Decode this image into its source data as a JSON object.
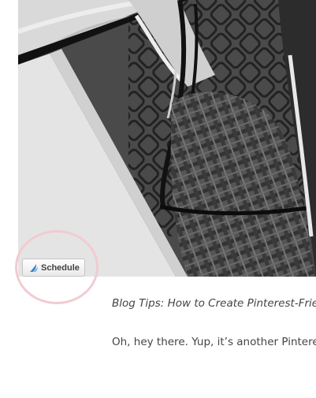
{
  "photo": {
    "alt": "Black and white photo of a person in a plaid sweater holding glasses by a chain-link fence"
  },
  "schedule_button": {
    "label": "Schedule",
    "icon": "buffer-icon",
    "icon_color": "#3b83c4"
  },
  "post": {
    "caption": "Blog Tips: How to Create Pinterest-Friendl",
    "body_text": "Oh, hey there. Yup, it’s another Pinterest-"
  },
  "colors": {
    "highlight_circle": "#f2cbd2",
    "text": "#444444"
  }
}
